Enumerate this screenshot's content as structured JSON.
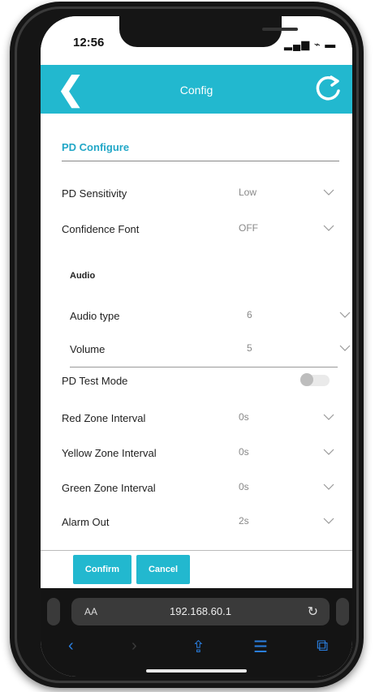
{
  "status": {
    "time": "12:56",
    "signal": "▂▄▆ ⌁ ▬"
  },
  "header": {
    "back_icon": "❮",
    "title": "Config"
  },
  "section": {
    "title": "PD Configure"
  },
  "settings": [
    {
      "label": "PD Sensitivity",
      "value": "Low"
    },
    {
      "label": "Confidence Font",
      "value": "OFF"
    }
  ],
  "audio": {
    "heading": "Audio",
    "items": [
      {
        "label": "Audio type",
        "value": "6"
      },
      {
        "label": "Volume",
        "value": "5"
      }
    ]
  },
  "test_mode": {
    "label": "PD Test Mode",
    "enabled": false
  },
  "intervals": [
    {
      "label": "Red Zone Interval",
      "value": "0s"
    },
    {
      "label": "Yellow Zone Interval",
      "value": "0s"
    },
    {
      "label": "Green Zone Interval",
      "value": "0s"
    },
    {
      "label": "Alarm Out",
      "value": "2s"
    }
  ],
  "buttons": {
    "confirm": "Confirm",
    "cancel": "Cancel"
  },
  "browser": {
    "text_size": "AA",
    "url": "192.168.60.1",
    "reload_icon": "↻",
    "toolbar": {
      "back": "‹",
      "forward": "›",
      "share": "⇪",
      "bookmarks": "☰",
      "tabs": "⧉"
    }
  },
  "colors": {
    "accent": "#22b8cf",
    "section_title": "#22a7c7",
    "browser_link": "#2a7fe0"
  }
}
